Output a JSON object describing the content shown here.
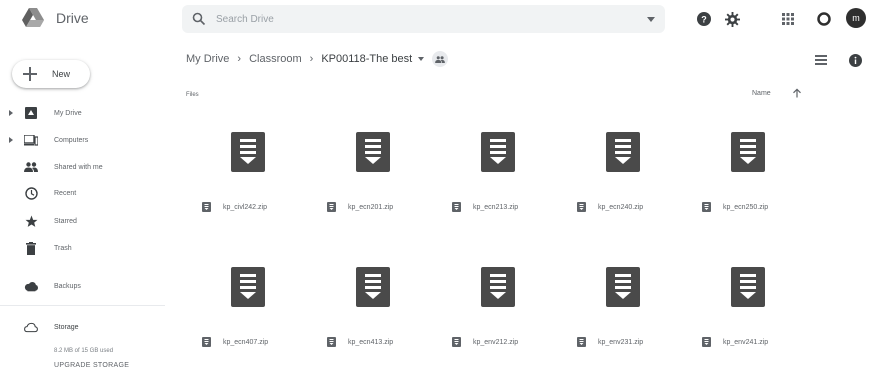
{
  "app": {
    "name": "Drive",
    "avatar_initial": "m"
  },
  "search": {
    "placeholder": "Search Drive"
  },
  "sidebar": {
    "new_label": "New",
    "items": [
      {
        "label": "My Drive",
        "icon": "my-drive-icon",
        "expandable": true,
        "active": true
      },
      {
        "label": "Computers",
        "icon": "computers-icon",
        "expandable": true
      },
      {
        "label": "Shared with me",
        "icon": "shared-with-me-icon"
      },
      {
        "label": "Recent",
        "icon": "clock-icon"
      },
      {
        "label": "Starred",
        "icon": "star-icon"
      },
      {
        "label": "Trash",
        "icon": "trash-icon"
      },
      {
        "label": "Backups",
        "icon": "cloud-icon"
      },
      {
        "label": "Storage",
        "icon": "cloud-outline-icon"
      }
    ],
    "storage_text": "8.2 MB of 15 GB used",
    "upgrade_label": "UPGRADE STORAGE"
  },
  "breadcrumb": {
    "root": "My Drive",
    "parent": "Classroom",
    "current": "KP00118-The best"
  },
  "main": {
    "section_label": "Files",
    "sort_label": "Name",
    "files": [
      {
        "name": "kp_civl242.zip"
      },
      {
        "name": "kp_ecn201.zip"
      },
      {
        "name": "kp_ecn213.zip"
      },
      {
        "name": "kp_ecn240.zip"
      },
      {
        "name": "kp_ecn250.zip"
      },
      {
        "name": "kp_ecn407.zip"
      },
      {
        "name": "kp_ecn413.zip"
      },
      {
        "name": "kp_env212.zip"
      },
      {
        "name": "kp_env231.zip"
      },
      {
        "name": "kp_env241.zip"
      }
    ]
  },
  "colors": {
    "accent": "#1a73e8",
    "icon_dark": "#5f6368",
    "thumb": "#4a4a4a",
    "search_bg": "#f1f3f4"
  }
}
